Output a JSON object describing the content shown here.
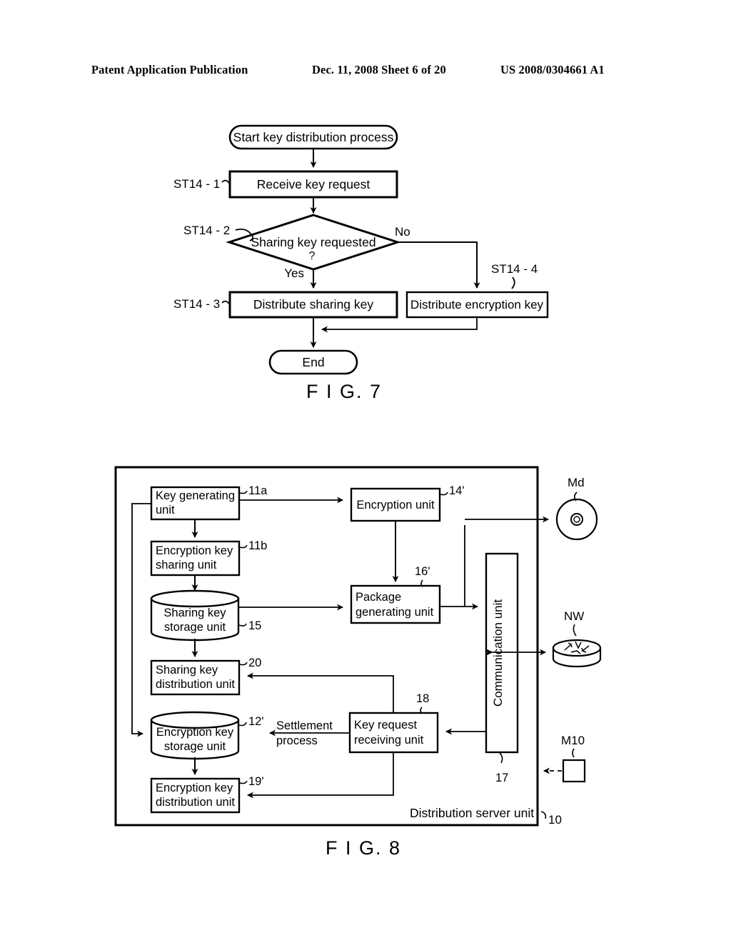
{
  "header": {
    "publication": "Patent Application Publication",
    "date_sheet": "Dec. 11, 2008  Sheet 6 of 20",
    "patent_number": "US 2008/0304661 A1"
  },
  "fig7": {
    "caption": "F I G. 7",
    "nodes": {
      "start": "Start key distribution process",
      "receive": "Receive key request",
      "decision": "Sharing key requested",
      "decision_mark": "?",
      "distribute_sharing": "Distribute sharing key",
      "distribute_encryption": "Distribute encryption key",
      "end": "End"
    },
    "edge_labels": {
      "yes": "Yes",
      "no": "No"
    },
    "step_labels": {
      "st14_1": "ST14 - 1",
      "st14_2": "ST14 - 2",
      "st14_3": "ST14 - 3",
      "st14_4": "ST14 - 4"
    }
  },
  "fig8": {
    "caption": "F I G. 8",
    "container_label": "Distribution server unit",
    "container_ref": "10",
    "blocks": {
      "key_generating": {
        "line1": "Key generating",
        "line2": "unit",
        "ref": "11a"
      },
      "encryption_key_sharing": {
        "line1": "Encryption key",
        "line2": "sharing unit",
        "ref": "11b"
      },
      "sharing_key_storage": {
        "line1": "Sharing key",
        "line2": "storage unit",
        "ref": "15"
      },
      "sharing_key_distribution": {
        "line1": "Sharing key",
        "line2": "distribution unit",
        "ref": "20"
      },
      "encryption_key_storage": {
        "line1": "Encryption key",
        "line2": "storage unit",
        "ref": "12'"
      },
      "encryption_key_distribution": {
        "line1": "Encryption key",
        "line2": "distribution unit",
        "ref": "19'"
      },
      "encryption_unit": {
        "line1": "Encryption unit",
        "line2": "",
        "ref": "14'"
      },
      "package_generating": {
        "line1": "Package",
        "line2": "generating unit",
        "ref": "16'"
      },
      "key_request_receiving": {
        "line1": "Key request",
        "line2": "receiving unit",
        "ref": "18"
      },
      "communication": {
        "line1": "Communication unit",
        "line2": "",
        "ref": "17"
      }
    },
    "annotations": {
      "settlement_line1": "Settlement",
      "settlement_line2": "process"
    },
    "external": {
      "media": {
        "label": "Md",
        "icon": "disc-icon"
      },
      "network": {
        "label": "NW",
        "icon": "network-cloud-icon"
      },
      "terminal": {
        "label": "M10",
        "icon": "square-terminal-icon"
      }
    }
  }
}
